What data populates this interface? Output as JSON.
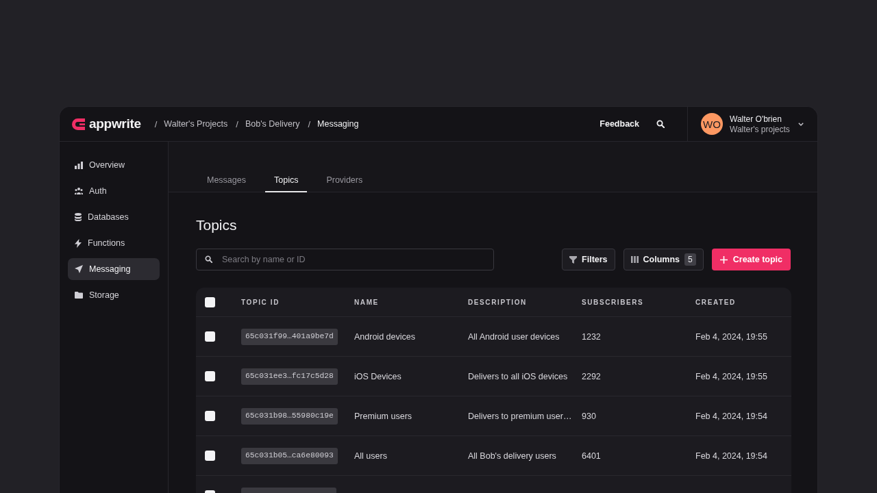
{
  "header": {
    "logo": "appwrite",
    "breadcrumbs": [
      {
        "separator": "/",
        "label": "Walter's Projects",
        "current": false
      },
      {
        "separator": "/",
        "label": "Bob's Delivery",
        "current": false
      },
      {
        "separator": "/",
        "label": "Messaging",
        "current": true
      }
    ],
    "feedback": "Feedback",
    "user": {
      "initials": "WO",
      "name": "Walter O'brien",
      "organization": "Walter's projects"
    }
  },
  "sidebar": {
    "items": [
      {
        "label": "Overview",
        "selected": false
      },
      {
        "label": "Auth",
        "selected": false
      },
      {
        "label": "Databases",
        "selected": false
      },
      {
        "label": "Functions",
        "selected": false
      },
      {
        "label": "Messaging",
        "selected": true
      },
      {
        "label": "Storage",
        "selected": false
      }
    ]
  },
  "tabs": [
    {
      "label": "Messages",
      "selected": false
    },
    {
      "label": "Topics",
      "selected": true
    },
    {
      "label": "Providers",
      "selected": false
    }
  ],
  "page_title": "Topics",
  "search": {
    "placeholder": "Search by name or ID"
  },
  "toolbar": {
    "filters": "Filters",
    "columns": {
      "label": "Columns",
      "count": "5"
    },
    "create": "Create topic"
  },
  "table": {
    "select_all_checked": false,
    "columns": [
      "TOPIC ID",
      "NAME",
      "DESCRIPTION",
      "SUBSCRIBERS",
      "CREATED"
    ],
    "rows": [
      {
        "checked": false,
        "topic_id": "65c031f99…401a9be7d",
        "name": "Android devices",
        "description": "All Android user devices",
        "subscribers": "1232",
        "created": "Feb 4, 2024, 19:55"
      },
      {
        "checked": false,
        "topic_id": "65c031ee3…fc17c5d28",
        "name": "iOS Devices",
        "description": "Delivers to all iOS devices",
        "subscribers": "2292",
        "created": "Feb 4, 2024, 19:55"
      },
      {
        "checked": false,
        "topic_id": "65c031b98…55980c19e",
        "name": "Premium users",
        "description": "Delivers to premium user…",
        "subscribers": "930",
        "created": "Feb 4, 2024, 19:54"
      },
      {
        "checked": false,
        "topic_id": "65c031b05…ca6e80093",
        "name": "All users",
        "description": "All Bob's delivery users",
        "subscribers": "6401",
        "created": "Feb 4, 2024, 19:54"
      },
      {
        "checked": false
      }
    ]
  }
}
